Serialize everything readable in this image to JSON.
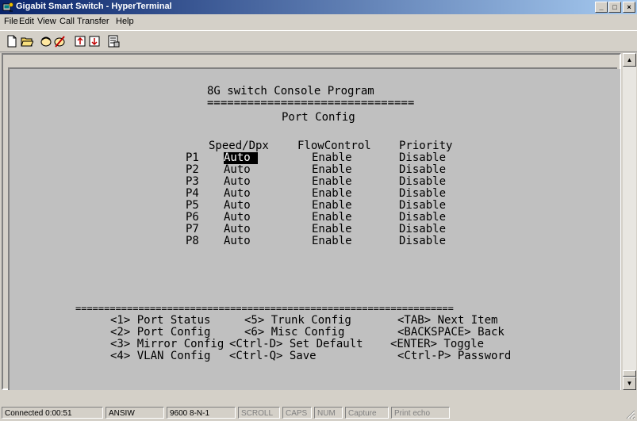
{
  "window": {
    "title": "Gigabit Smart Switch - HyperTerminal"
  },
  "menu": [
    "File",
    "Edit",
    "View",
    "Call",
    "Transfer",
    "Help"
  ],
  "toolbar": [
    "new-icon",
    "open-icon",
    "call-icon",
    "disconnect-icon",
    "send-icon",
    "receive-icon",
    "properties-icon"
  ],
  "terminal": {
    "heading": "8G switch Console Program",
    "heading_rule": "===============================",
    "subheading": "Port Config",
    "col_speed": "Speed/Dpx",
    "col_flow": "FlowControl",
    "col_priority": "Priority",
    "ports": [
      {
        "port": "P1",
        "speed": "Auto",
        "flow": "Enable",
        "priority": "Disable"
      },
      {
        "port": "P2",
        "speed": "Auto",
        "flow": "Enable",
        "priority": "Disable"
      },
      {
        "port": "P3",
        "speed": "Auto",
        "flow": "Enable",
        "priority": "Disable"
      },
      {
        "port": "P4",
        "speed": "Auto",
        "flow": "Enable",
        "priority": "Disable"
      },
      {
        "port": "P5",
        "speed": "Auto",
        "flow": "Enable",
        "priority": "Disable"
      },
      {
        "port": "P6",
        "speed": "Auto",
        "flow": "Enable",
        "priority": "Disable"
      },
      {
        "port": "P7",
        "speed": "Auto",
        "flow": "Enable",
        "priority": "Disable"
      },
      {
        "port": "P8",
        "speed": "Auto",
        "flow": "Enable",
        "priority": "Disable"
      }
    ],
    "footer_rule": "==================================================================",
    "menu_lines": [
      [
        "<1> Port Status",
        "<5> Trunk Config",
        "<TAB> Next Item"
      ],
      [
        "<2> Port Config",
        "<6> Misc Config",
        "<BACKSPACE> Back"
      ],
      [
        "<3> Mirror Config",
        "<Ctrl-D> Set Default",
        "<ENTER> Toggle"
      ],
      [
        "<4> VLAN Config",
        "<Ctrl-Q> Save",
        "<Ctrl-P> Password"
      ]
    ]
  },
  "status": {
    "connected": "Connected 0:00:51",
    "emulation": "ANSIW",
    "settings": "9600 8-N-1",
    "scroll": "SCROLL",
    "caps": "CAPS",
    "num": "NUM",
    "capture": "Capture",
    "echo": "Print echo"
  }
}
